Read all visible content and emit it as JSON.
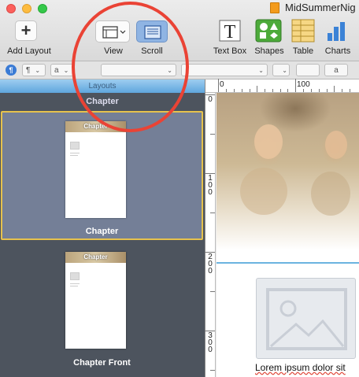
{
  "window": {
    "title": "MidSummerNig"
  },
  "toolbar": {
    "add_layout": "Add Layout",
    "view": "View",
    "scroll": "Scroll",
    "text_box": "Text Box",
    "shapes": "Shapes",
    "table": "Table",
    "charts": "Charts"
  },
  "formatbar": {
    "para_style": "¶",
    "char_style": "a",
    "swatch_label": "a"
  },
  "sidebar": {
    "header": "Layouts",
    "top_label": "Chapter",
    "layouts": [
      {
        "label": "Chapter",
        "thumb_title": "Chapter",
        "selected": true
      },
      {
        "label": "Chapter Front",
        "thumb_title": "Chapter",
        "selected": false
      }
    ]
  },
  "ruler": {
    "top": [
      "0",
      "100"
    ],
    "left": [
      [
        "0"
      ],
      [
        "1",
        "0",
        "0"
      ],
      [
        "2",
        "0",
        "0"
      ],
      [
        "3",
        "0",
        "0"
      ]
    ]
  },
  "page": {
    "body_text": "Lorem ipsum dolor sit"
  },
  "colors": {
    "annotation": "#ea4335",
    "selection": "#e6c24d",
    "scroll_active": "#8fb4e3"
  }
}
